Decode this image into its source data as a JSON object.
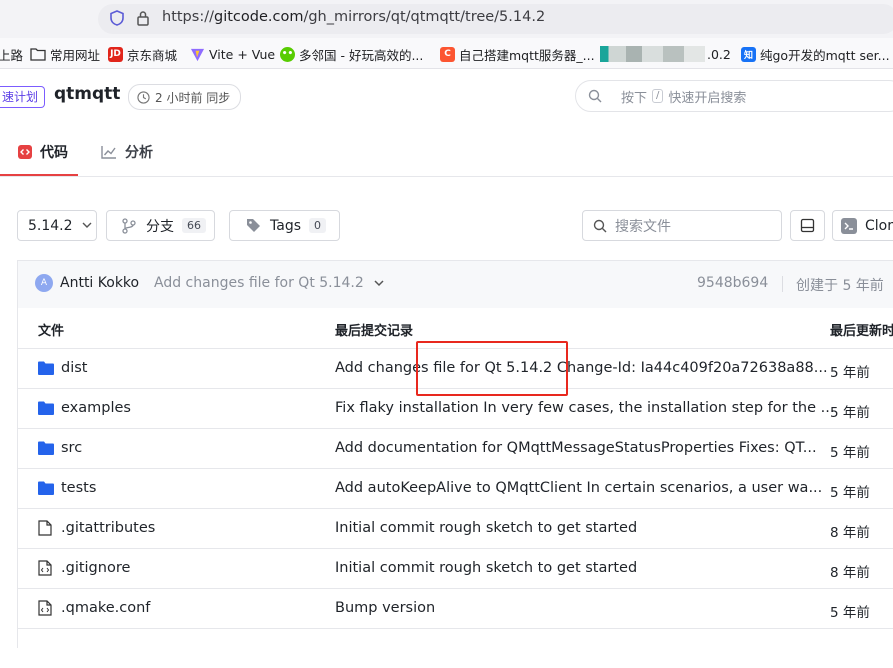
{
  "browser": {
    "url_prefix": "https://",
    "url_host": "gitcode.com",
    "url_path": "/gh_mirrors/qt/qtmqtt/tree/5.14.2"
  },
  "bookmarks": [
    {
      "label": "上路"
    },
    {
      "label": "常用网址"
    },
    {
      "label": "京东商城",
      "icon_text": "JD"
    },
    {
      "label": "Vite + Vue"
    },
    {
      "label": "多邻国 - 好玩高效的..."
    },
    {
      "label": "自己搭建mqtt服务器_...",
      "icon_text": "C"
    },
    {
      "label": ".0.2"
    },
    {
      "label": "纯go开发的mqtt ser...",
      "icon_text": "知"
    }
  ],
  "repo": {
    "speed_tag": "速计划",
    "name": "qtmqtt",
    "sync_label": "2 小时前 同步",
    "search_prefix": "按下",
    "search_key": "/",
    "search_suffix": "快速开启搜索"
  },
  "tabs": [
    {
      "label": "代码",
      "active": true
    },
    {
      "label": "分析",
      "active": false
    }
  ],
  "toolbar": {
    "branch": "5.14.2",
    "branches_label": "分支",
    "branches_count": "66",
    "tags_label": "Tags",
    "tags_count": "0",
    "file_search_placeholder": "搜索文件",
    "clone_label": "Clor"
  },
  "last_commit": {
    "avatar_letter": "A",
    "author": "Antti Kokko",
    "message": "Add changes file for Qt 5.14.2",
    "hash": "9548b694",
    "created": "创建于 5 年前"
  },
  "table": {
    "headers": {
      "file": "文件",
      "commit": "最后提交记录",
      "updated": "最后更新时"
    },
    "rows": [
      {
        "type": "folder",
        "name": "dist",
        "message": "Add changes file for Qt 5.14.2 Change-Id: Ia44c409f20a72638a88...",
        "time": "5 年前"
      },
      {
        "type": "folder",
        "name": "examples",
        "message": "Fix flaky installation In very few cases, the installation step for the ...",
        "time": "5 年前"
      },
      {
        "type": "folder",
        "name": "src",
        "message": "Add documentation for QMqttMessageStatusProperties Fixes: QT...",
        "time": "5 年前"
      },
      {
        "type": "folder",
        "name": "tests",
        "message": "Add autoKeepAlive to QMqttClient In certain scenarios, a user wa...",
        "time": "5 年前"
      },
      {
        "type": "file",
        "name": ".gitattributes",
        "message": "Initial commit rough sketch to get started",
        "time": "8 年前"
      },
      {
        "type": "code",
        "name": ".gitignore",
        "message": "Initial commit rough sketch to get started",
        "time": "8 年前"
      },
      {
        "type": "code",
        "name": ".qmake.conf",
        "message": "Bump version",
        "time": "5 年前"
      }
    ]
  },
  "colors": {
    "folder": "#2463eb",
    "accent_red": "#e64142",
    "highlight_box": "#e8281e"
  }
}
